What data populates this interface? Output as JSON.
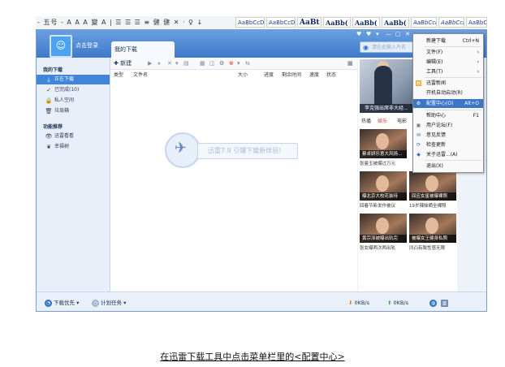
{
  "word_ribbon": {
    "left_text": "- 五号 - A A A 變 A | ☰ ☰ ☰ ≡ 健 健 ✕ · ♀ ↓",
    "styles": [
      "AaBbCcDd",
      "AaBbCcDd",
      "AaBt",
      "AaBb(",
      "AaBb(",
      "AaBb(",
      "AaBbCcDd",
      "AaBbCcDd",
      "AaBbCcDd"
    ]
  },
  "app": {
    "login_text": "点击登录",
    "tab_label": "我的下载",
    "search_placeholder": "请在此输入片名",
    "title_controls": [
      "♥",
      "♥",
      "▾",
      "—",
      "▢",
      "✕"
    ]
  },
  "sidebar": {
    "section1": "我的下载",
    "items1": [
      {
        "icon": "download-icon",
        "glyph": "⤓",
        "label": "正在下载"
      },
      {
        "icon": "check-icon",
        "glyph": "✓",
        "label": "已完成(10)"
      },
      {
        "icon": "lock-icon",
        "glyph": "🔒",
        "label": "私人空间"
      },
      {
        "icon": "trash-icon",
        "glyph": "🗑",
        "label": "垃圾箱"
      }
    ],
    "section2": "功能推荐",
    "items2": [
      {
        "icon": "eye-icon",
        "glyph": "👁",
        "label": "迅雷看看"
      },
      {
        "icon": "leaf-icon",
        "glyph": "❦",
        "label": "幸福树"
      }
    ]
  },
  "toolbar": {
    "new_label": "新建",
    "icons": [
      "▶",
      "⏸",
      "✕",
      "▾",
      "▤",
      "▦",
      "◫",
      "⚙",
      "⊕",
      "▾",
      "⇆"
    ]
  },
  "columns": [
    "类型",
    "文件名",
    "大小",
    "进度",
    "剩余时间",
    "速度",
    "状态"
  ],
  "promo_text": "迅雷7.9 引爆下载新体验!",
  "right_panel": {
    "hero_caption": "李克强出席非大经...",
    "tabs": [
      "热播",
      "娱乐",
      "电影"
    ],
    "thumbs": [
      {
        "caption": "蔡卓妍乐意大风扬..."
      },
      {
        "caption": "曝北京大校花装待"
      },
      {
        "caption": "回应女星被曝裸照"
      },
      {
        "caption": "黄宗泽被曝出轨完"
      },
      {
        "caption": "被曝女王健身私照"
      }
    ],
    "under_lines": [
      "张曼玉被爆过万元",
      "回春节新发作被议",
      "19岁辣妹晒全裸照",
      "张女曝两次两出轨",
      "凹凸有致性感无限"
    ]
  },
  "statusbar": {
    "priority": "下载优先",
    "plan": "计划任务",
    "down_speed": "0KB/s",
    "up_speed": "0KB/s"
  },
  "menu": {
    "items": [
      {
        "label": "新建下载",
        "shortcut": "Ctrl+N"
      },
      {
        "label": "文件(F)",
        "arrow": "›"
      },
      {
        "label": "编辑(E)",
        "arrow": "›"
      },
      {
        "label": "工具(T)",
        "arrow": "›"
      },
      {
        "label": "迅雷新闻"
      },
      {
        "label": "开机自动启动(R)"
      },
      {
        "label": "配置中心(O)",
        "shortcut": "Alt+O"
      },
      {
        "label": "帮助中心",
        "shortcut": "F1"
      },
      {
        "label": "用户论坛(F)"
      },
      {
        "label": "意见反馈"
      },
      {
        "label": "检查更新"
      },
      {
        "label": "关于迅雷...(A)"
      },
      {
        "label": "退出(X)"
      }
    ]
  },
  "caption": "在迅雷下载工具中点击菜单栏里的<配置中心>"
}
